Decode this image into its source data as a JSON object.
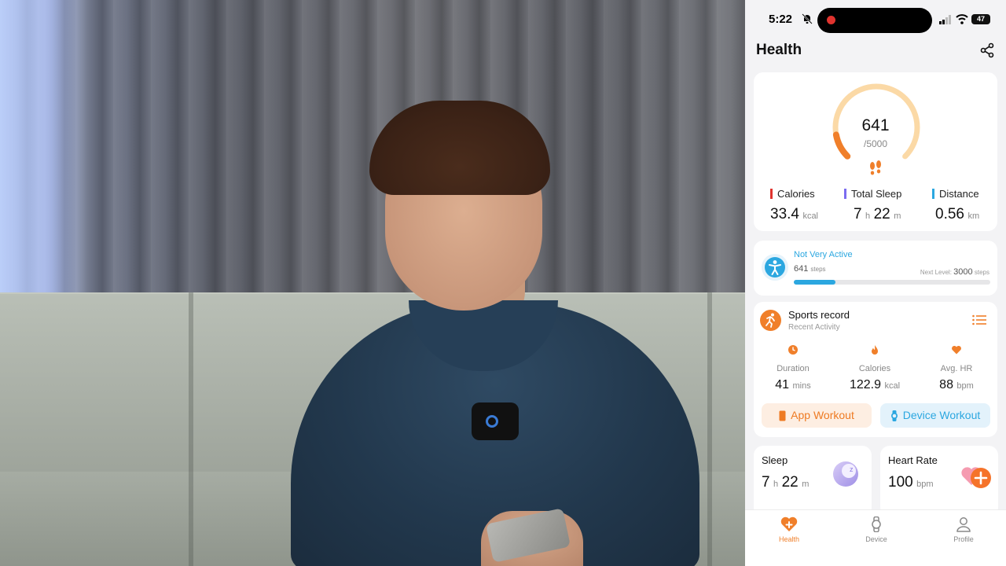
{
  "status_bar": {
    "time": "5:22",
    "battery": "47"
  },
  "header": {
    "title": "Health"
  },
  "steps": {
    "value": "641",
    "goal": "/5000",
    "progress": 0.128
  },
  "summary": {
    "calories": {
      "label": "Calories",
      "value": "33.4",
      "unit": "kcal",
      "color": "#e0332e"
    },
    "sleep": {
      "label": "Total Sleep",
      "hours": "7",
      "h_unit": "h",
      "minutes": "22",
      "m_unit": "m",
      "color": "#7b6cf0"
    },
    "distance": {
      "label": "Distance",
      "value": "0.56",
      "unit": "km",
      "color": "#2ba7e0"
    }
  },
  "activity": {
    "level": "Not Very Active",
    "steps": "641",
    "steps_unit": "steps",
    "next_label": "Next Level:",
    "next_value": "3000",
    "next_unit": "steps",
    "progress": 0.21
  },
  "sports": {
    "title": "Sports record",
    "subtitle": "Recent Activity",
    "duration": {
      "label": "Duration",
      "value": "41",
      "unit": "mins"
    },
    "calories": {
      "label": "Calories",
      "value": "122.9",
      "unit": "kcal"
    },
    "hr": {
      "label": "Avg. HR",
      "value": "88",
      "unit": "bpm"
    },
    "app_workout": "App Workout",
    "device_workout": "Device Workout"
  },
  "sleep_card": {
    "title": "Sleep",
    "hours": "7",
    "h_unit": "h",
    "minutes": "22",
    "m_unit": "m"
  },
  "hr_card": {
    "title": "Heart Rate",
    "value": "100",
    "unit": "bpm"
  },
  "tabs": [
    {
      "label": "Health",
      "icon": "heart-plus-icon",
      "active": true
    },
    {
      "label": "Device",
      "icon": "watch-icon",
      "active": false
    },
    {
      "label": "Profile",
      "icon": "person-icon",
      "active": false
    }
  ],
  "colors": {
    "accent": "#f07f2a",
    "blue": "#2ba7e0"
  }
}
